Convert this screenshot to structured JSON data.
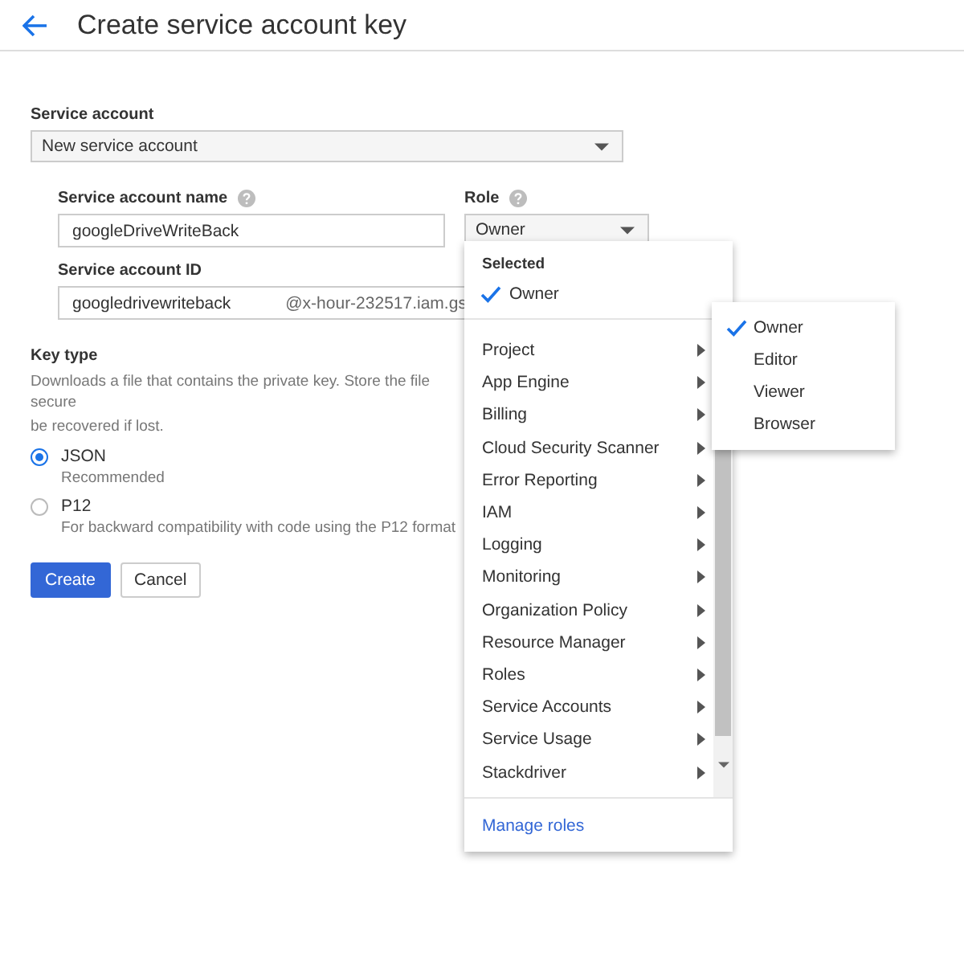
{
  "header": {
    "title": "Create service account key"
  },
  "service_account": {
    "label": "Service account",
    "value": "New service account"
  },
  "name_field": {
    "label": "Service account name",
    "value": "googleDriveWriteBack"
  },
  "role": {
    "label": "Role",
    "value": "Owner"
  },
  "id_field": {
    "label": "Service account ID",
    "value": "googledrivewriteback",
    "suffix": "@x-hour-232517.iam.gs"
  },
  "key_type": {
    "label": "Key type",
    "description": [
      "Downloads a file that contains the private key. Store the file secure",
      "be recovered if lost."
    ],
    "options": [
      {
        "label": "JSON",
        "note": "Recommended",
        "selected": true
      },
      {
        "label": "P12",
        "note": "For backward compatibility with code using the P12 format",
        "selected": false
      }
    ]
  },
  "buttons": [
    {
      "label": "Create",
      "kind": "primary"
    },
    {
      "label": "Cancel",
      "kind": "secondary"
    }
  ],
  "role_menu": {
    "selected_heading": "Selected",
    "selected_items": [
      "Owner"
    ],
    "categories": [
      "Project",
      "App Engine",
      "Billing",
      "Cloud Security Scanner",
      "Error Reporting",
      "IAM",
      "Logging",
      "Monitoring",
      "Organization Policy",
      "Resource Manager",
      "Roles",
      "Service Accounts",
      "Service Usage",
      "Stackdriver"
    ],
    "footer_link": "Manage roles"
  },
  "submenu": {
    "items": [
      {
        "label": "Owner",
        "selected": true
      },
      {
        "label": "Editor",
        "selected": false
      },
      {
        "label": "Viewer",
        "selected": false
      },
      {
        "label": "Browser",
        "selected": false
      }
    ]
  }
}
